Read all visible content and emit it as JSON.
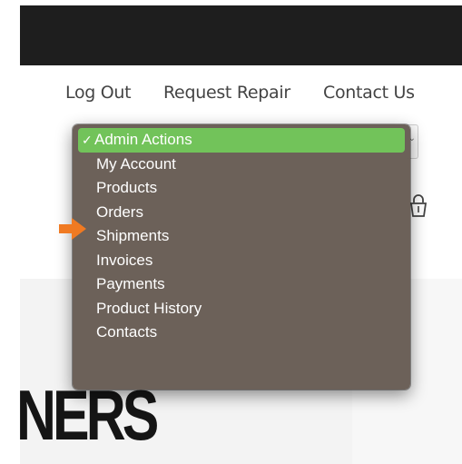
{
  "nav": {
    "logout": "Log Out",
    "request_repair": "Request Repair",
    "contact_us": "Contact Us"
  },
  "dropdown": {
    "check_mark": "✓",
    "selected_value": "Admin Actions",
    "options": [
      "Admin Actions",
      "My Account",
      "Products",
      "Orders",
      "Shipments",
      "Invoices",
      "Payments",
      "Product History",
      "Contacts"
    ],
    "highlight_color": "#72c35a",
    "menu_color": "#675c54"
  },
  "hero": {
    "text": "NERS"
  },
  "colors": {
    "topbar": "#1e1e1e",
    "pointer_arrow": "#f07a22"
  },
  "icons": [
    "cart-icon",
    "pointer-arrow-icon",
    "chevron-down-icon"
  ]
}
